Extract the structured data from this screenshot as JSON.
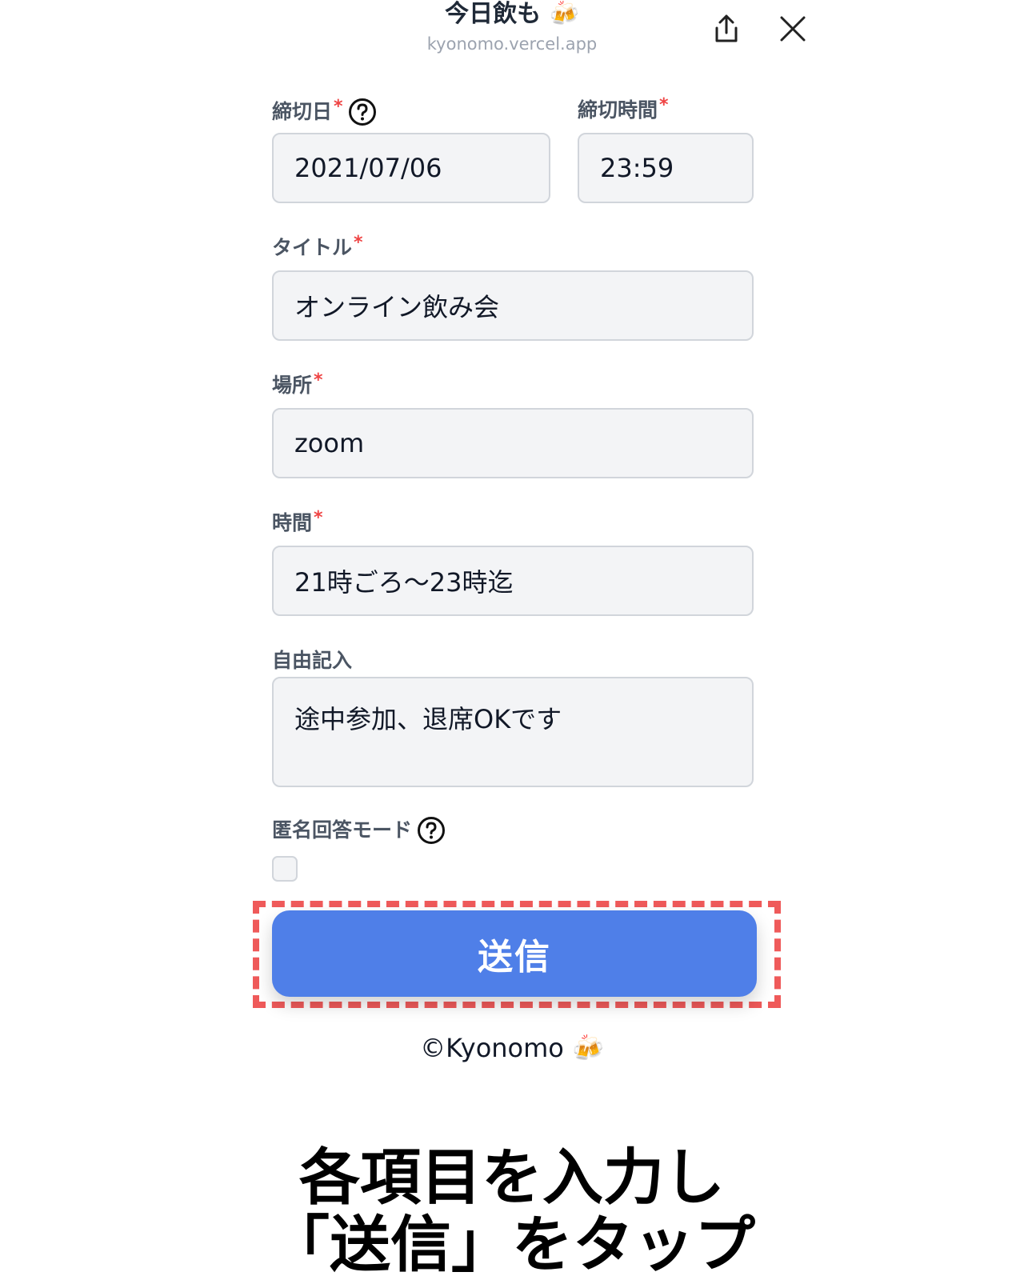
{
  "header": {
    "title": "今日飲も 🍻",
    "url": "kyonomo.vercel.app",
    "share_icon": "share-icon",
    "close_icon": "close-icon"
  },
  "form": {
    "deadline_date": {
      "label": "締切日",
      "required_mark": "*",
      "value": "2021/07/06",
      "help_icon": "question-circle-icon"
    },
    "deadline_time": {
      "label": "締切時間",
      "required_mark": "*",
      "value": "23:59"
    },
    "title": {
      "label": "タイトル",
      "required_mark": "*",
      "value": "オンライン飲み会"
    },
    "place": {
      "label": "場所",
      "required_mark": "*",
      "value": "zoom"
    },
    "time": {
      "label": "時間",
      "required_mark": "*",
      "value": "21時ごろ〜23時迄"
    },
    "free_text": {
      "label": "自由記入",
      "value": "途中参加、退席OKです"
    },
    "anonymous_mode": {
      "label": "匿名回答モード",
      "checked": false,
      "help_icon": "question-circle-icon"
    },
    "submit_label": "送信"
  },
  "footer": {
    "copyright": "©Kyonomo 🍻"
  },
  "caption": {
    "line1": "各項目を入力し",
    "line2": "「送信」をタップ"
  },
  "colors": {
    "primary_button": "#4f7fe8",
    "highlight_dash": "#ef5a5a",
    "required": "#ef4444",
    "field_bg": "#f3f4f6"
  }
}
